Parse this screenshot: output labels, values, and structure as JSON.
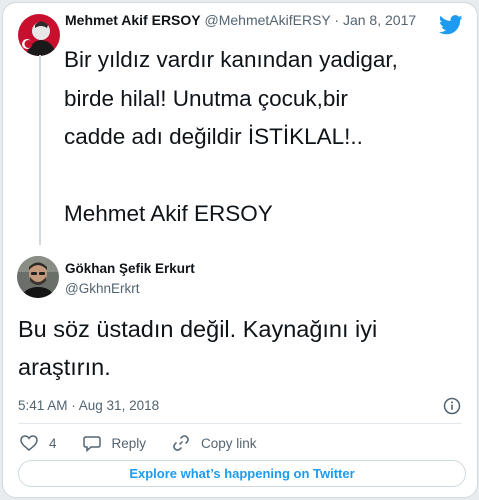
{
  "quoted_tweet": {
    "author_name": "Mehmet Akif ERSOY",
    "author_handle": "@MehmetAkifERSY",
    "separator": "·",
    "date": "Jan 8, 2017",
    "text": "Bir yıldız vardır kanından yadigar,\nbirde hilal! Unutma çocuk,bir\ncadde adı değildir İSTİKLAL!..\n\nMehmet Akif ERSOY"
  },
  "tweet": {
    "author_name": "Gökhan Şefik Erkurt",
    "author_handle": "@GkhnErkrt",
    "text": "Bu söz üstadın değil. Kaynağını iyi\naraştırın.",
    "timestamp": "5:41 AM · Aug 31, 2018"
  },
  "actions": {
    "like_count": "4",
    "reply_label": "Reply",
    "copy_link_label": "Copy link"
  },
  "explore_label": "Explore what’s happening on Twitter",
  "icons": {
    "brand": "twitter-bird-icon",
    "info": "info-icon",
    "like": "heart-icon",
    "reply": "reply-bubble-icon",
    "link": "link-icon"
  },
  "colors": {
    "brand_blue": "#1d9bf0",
    "secondary_text": "#536471",
    "primary_text": "#0f1419"
  }
}
